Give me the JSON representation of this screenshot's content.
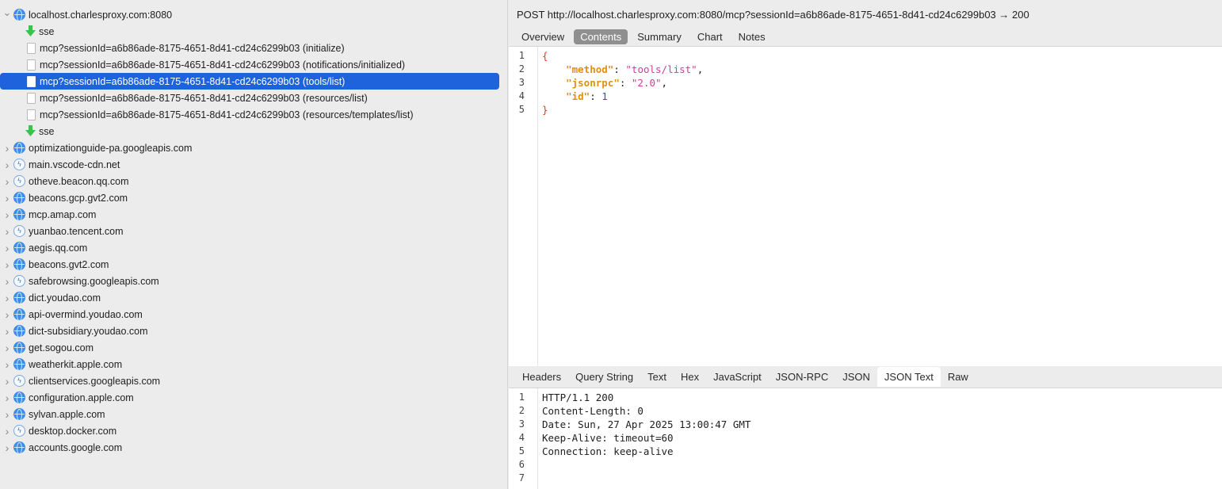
{
  "tree": {
    "root": {
      "label": "localhost.charlesproxy.com:8080"
    },
    "children": [
      {
        "label": "sse",
        "type": "sse"
      },
      {
        "label": "mcp?sessionId=a6b86ade-8175-4651-8d41-cd24c6299b03 (initialize)",
        "type": "doc"
      },
      {
        "label": "mcp?sessionId=a6b86ade-8175-4651-8d41-cd24c6299b03 (notifications/initialized)",
        "type": "doc"
      },
      {
        "label": "mcp?sessionId=a6b86ade-8175-4651-8d41-cd24c6299b03 (tools/list)",
        "type": "doc",
        "selected": true
      },
      {
        "label": "mcp?sessionId=a6b86ade-8175-4651-8d41-cd24c6299b03 (resources/list)",
        "type": "doc"
      },
      {
        "label": "mcp?sessionId=a6b86ade-8175-4651-8d41-cd24c6299b03 (resources/templates/list)",
        "type": "doc"
      },
      {
        "label": "sse",
        "type": "sse"
      }
    ],
    "hosts": [
      {
        "label": "optimizationguide-pa.googleapis.com",
        "icon": "globe"
      },
      {
        "label": "main.vscode-cdn.net",
        "icon": "bolt"
      },
      {
        "label": "otheve.beacon.qq.com",
        "icon": "bolt"
      },
      {
        "label": "beacons.gcp.gvt2.com",
        "icon": "globe"
      },
      {
        "label": "mcp.amap.com",
        "icon": "globe"
      },
      {
        "label": "yuanbao.tencent.com",
        "icon": "bolt"
      },
      {
        "label": "aegis.qq.com",
        "icon": "globe"
      },
      {
        "label": "beacons.gvt2.com",
        "icon": "globe"
      },
      {
        "label": "safebrowsing.googleapis.com",
        "icon": "bolt"
      },
      {
        "label": "dict.youdao.com",
        "icon": "globe"
      },
      {
        "label": "api-overmind.youdao.com",
        "icon": "globe"
      },
      {
        "label": "dict-subsidiary.youdao.com",
        "icon": "globe"
      },
      {
        "label": "get.sogou.com",
        "icon": "globe"
      },
      {
        "label": "weatherkit.apple.com",
        "icon": "globe"
      },
      {
        "label": "clientservices.googleapis.com",
        "icon": "bolt"
      },
      {
        "label": "configuration.apple.com",
        "icon": "globe"
      },
      {
        "label": "sylvan.apple.com",
        "icon": "globe"
      },
      {
        "label": "desktop.docker.com",
        "icon": "bolt"
      },
      {
        "label": "accounts.google.com",
        "icon": "globe"
      }
    ]
  },
  "detail": {
    "url": "POST http://localhost.charlesproxy.com:8080/mcp?sessionId=a6b86ade-8175-4651-8d41-cd24c6299b03 → 200",
    "top_tabs": [
      {
        "label": "Overview"
      },
      {
        "label": "Contents",
        "active": true
      },
      {
        "label": "Summary"
      },
      {
        "label": "Chart"
      },
      {
        "label": "Notes"
      }
    ],
    "request_json": {
      "open": "{",
      "close": "}",
      "entries": [
        {
          "key": "\"method\"",
          "value": "\"tools/list\"",
          "kind": "str",
          "comma": ","
        },
        {
          "key": "\"jsonrpc\"",
          "value": "\"2.0\"",
          "kind": "str",
          "comma": ","
        },
        {
          "key": "\"id\"",
          "value": "1",
          "kind": "num",
          "comma": ""
        }
      ]
    },
    "bottom_tabs": [
      {
        "label": "Headers"
      },
      {
        "label": "Query String"
      },
      {
        "label": "Text"
      },
      {
        "label": "Hex"
      },
      {
        "label": "JavaScript"
      },
      {
        "label": "JSON-RPC"
      },
      {
        "label": "JSON"
      },
      {
        "label": "JSON Text",
        "active": true
      },
      {
        "label": "Raw"
      }
    ],
    "response_lines": [
      "HTTP/1.1 200",
      "Content-Length: 0",
      "Date: Sun, 27 Apr 2025 13:00:47 GMT",
      "Keep-Alive: timeout=60",
      "Connection: keep-alive",
      "",
      ""
    ],
    "line_numbers_top": [
      "1",
      "2",
      "3",
      "4",
      "5"
    ],
    "line_numbers_bottom": [
      "1",
      "2",
      "3",
      "4",
      "5",
      "6",
      "7"
    ]
  }
}
